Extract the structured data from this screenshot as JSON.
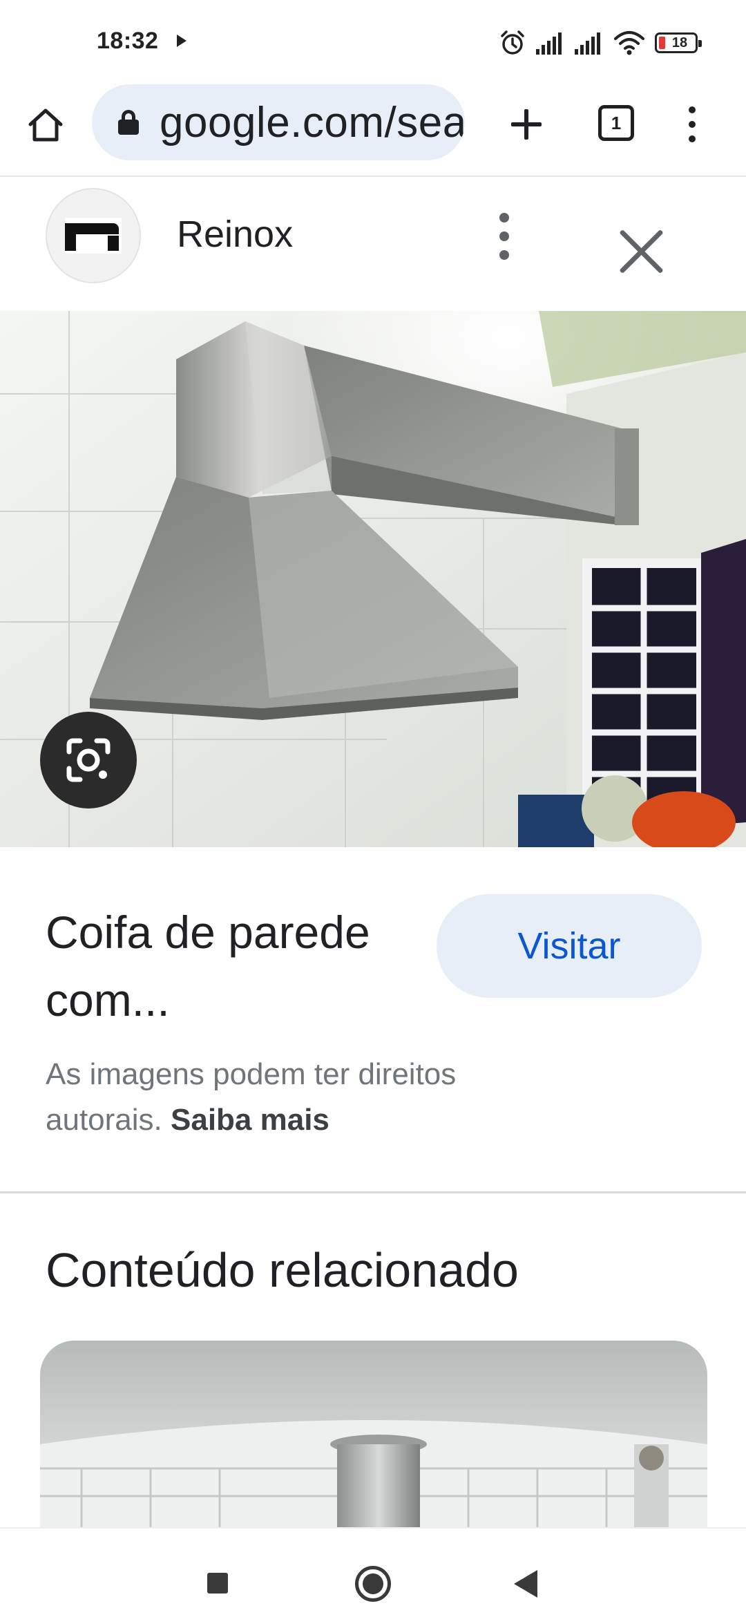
{
  "status_bar": {
    "time": "18:32",
    "battery_level": "18",
    "icons": [
      "play-icon",
      "alarm-icon",
      "signal-icon",
      "signal-icon",
      "wifi-icon",
      "battery-icon"
    ]
  },
  "browser": {
    "url": "google.com/search",
    "tab_count": "1",
    "icons": [
      "home-icon",
      "lock-icon",
      "plus-icon",
      "tabs-icon",
      "more-vert-icon"
    ]
  },
  "source": {
    "name": "Reinox"
  },
  "result": {
    "title": "Coifa de parede com...",
    "visit_label": "Visitar",
    "copyright_text": "As imagens podem ter direitos autorais.",
    "learn_more": "Saiba mais"
  },
  "related": {
    "heading": "Conteúdo relacionado"
  },
  "colors": {
    "accent": "#0b57d0",
    "pill_bg": "#e8eef8",
    "battery_low": "#e53935"
  }
}
